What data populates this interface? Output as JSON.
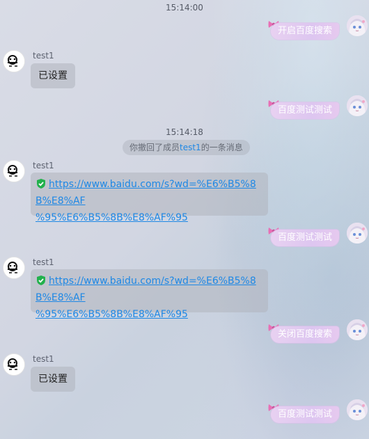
{
  "chat": {
    "timestamps": [
      "15:14:00",
      "15:14:18"
    ],
    "recall_notice": {
      "prefix": "你撤回了成员",
      "member": "test1",
      "suffix": "的一条消息"
    },
    "messages": [
      {
        "side": "right",
        "text": "开启百度搜索"
      },
      {
        "side": "left",
        "sender": "test1",
        "text": "已设置"
      },
      {
        "side": "right",
        "text": "百度测试测试"
      },
      {
        "side": "left",
        "sender": "test1",
        "link_line1": "https://www.baidu.com/s?wd=%E6%B5%8B%E8%AF",
        "link_line2": "%95%E6%B5%8B%E8%AF%95"
      },
      {
        "side": "right",
        "text": "百度测试测试"
      },
      {
        "side": "left",
        "sender": "test1",
        "link_line1": "https://www.baidu.com/s?wd=%E6%B5%8B%E8%AF",
        "link_line2": "%95%E6%B5%8B%E8%AF%95"
      },
      {
        "side": "right",
        "text": "关闭百度搜索"
      },
      {
        "side": "left",
        "sender": "test1",
        "text": "已设置"
      },
      {
        "side": "right",
        "text": "百度测试测试"
      }
    ]
  },
  "icons": {
    "left_avatar": "robot-avatar-icon",
    "right_avatar": "anime-girl-avatar-icon",
    "verified": "green-shield-check-icon",
    "bubble_decoration": "pink-bow-icon"
  },
  "colors": {
    "link": "#1e88e5",
    "verified_green": "#22b14c",
    "bubble_right": "#ddc6f0"
  }
}
